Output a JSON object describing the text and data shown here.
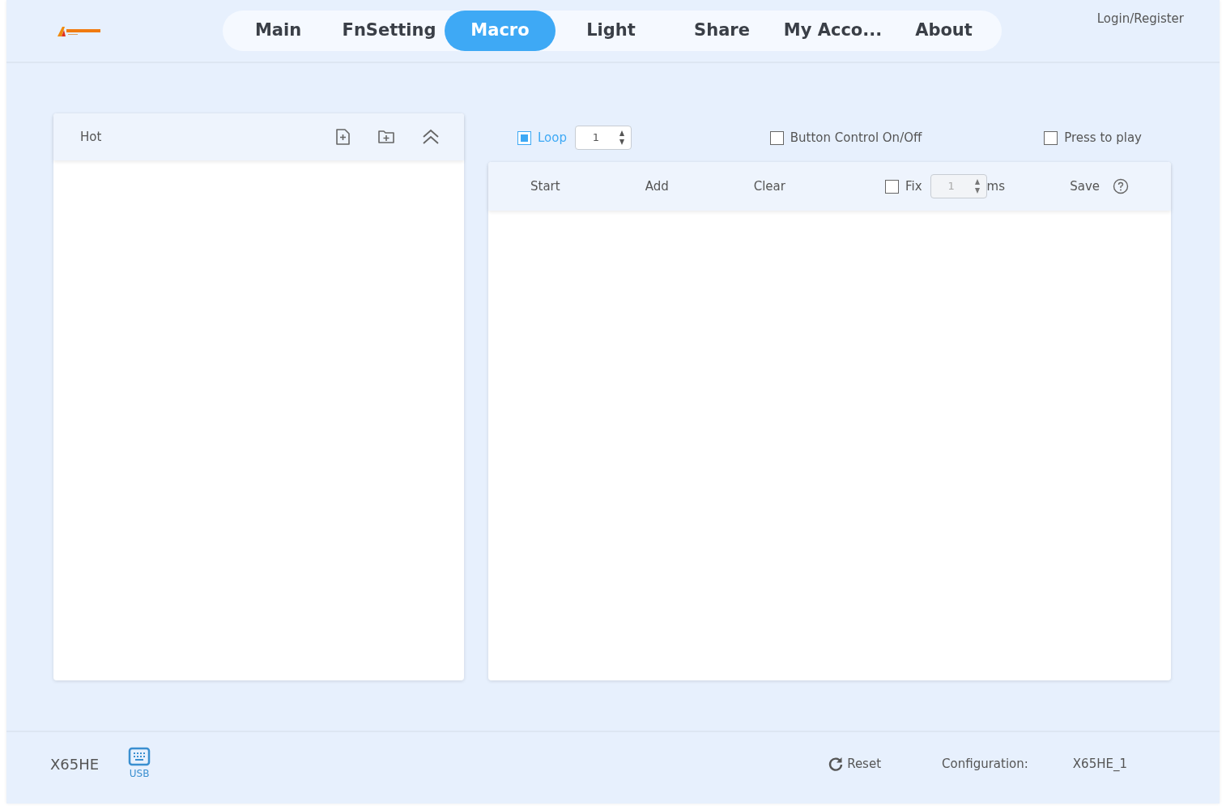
{
  "header": {
    "tabs": [
      {
        "label": "Main",
        "selected": false
      },
      {
        "label": "FnSetting",
        "selected": false
      },
      {
        "label": "Macro",
        "selected": true
      },
      {
        "label": "Light",
        "selected": false
      },
      {
        "label": "Share",
        "selected": false
      },
      {
        "label": "My Acco...",
        "selected": false
      },
      {
        "label": "About",
        "selected": false
      }
    ],
    "login": "Login/Register"
  },
  "macro_list": {
    "title": "Hot"
  },
  "options": [
    {
      "label": "Loop",
      "checked": true,
      "count": "1"
    },
    {
      "label": "Button Control On/Off",
      "checked": false
    },
    {
      "label": "Press to play",
      "checked": false
    }
  ],
  "toolbar": {
    "start": "Start",
    "add": "Add",
    "clear": "Clear",
    "fix": {
      "label": "Fix",
      "checked": false,
      "value": "1",
      "disabled": true,
      "unit": "ms"
    },
    "save": "Save"
  },
  "status_bar": {
    "device": "X65HE",
    "connection": "USB",
    "reset": "Reset",
    "config_label": "Configuration:",
    "config_value": "X65HE_1"
  }
}
